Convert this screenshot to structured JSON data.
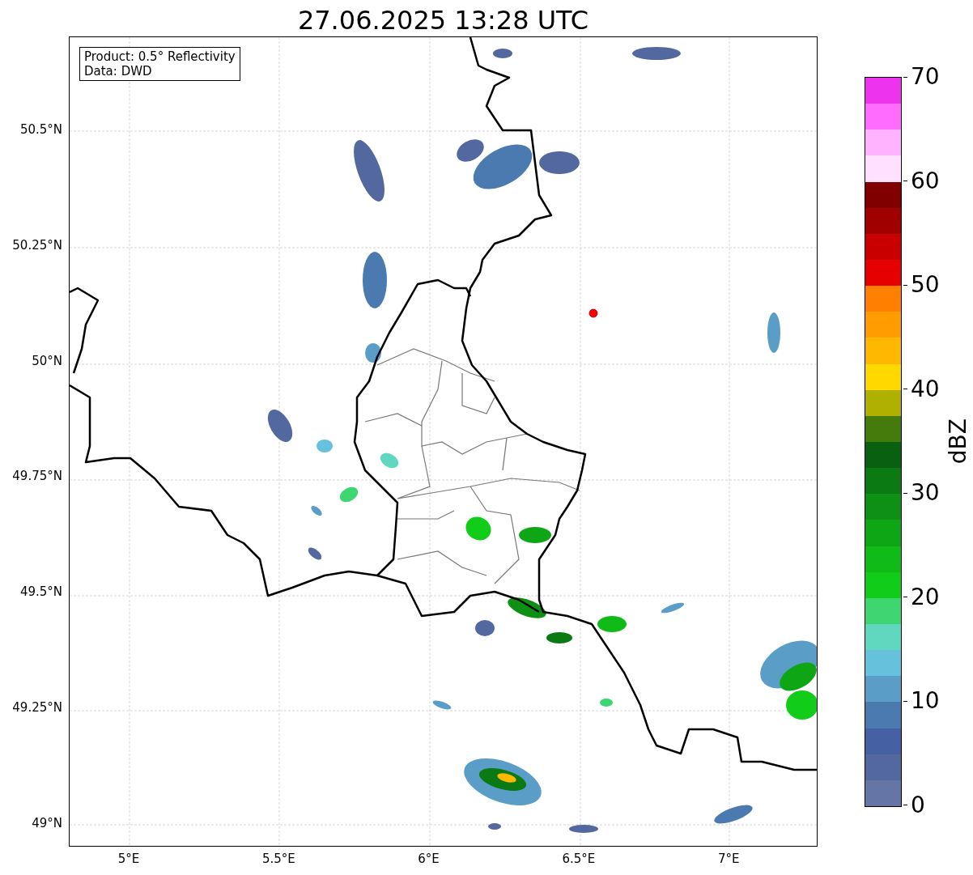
{
  "title": "27.06.2025 13:28 UTC",
  "legend": {
    "lines": [
      "Product: 0.5° Reflectivity",
      "Data: DWD"
    ]
  },
  "y_ticks": [
    "50.5°N",
    "50.25°N",
    "50°N",
    "49.75°N",
    "49.5°N",
    "49.25°N",
    "49°N"
  ],
  "x_ticks": [
    "5°E",
    "5.5°E",
    "6°E",
    "6.5°E",
    "7°E"
  ],
  "colorbar": {
    "label": "dBZ",
    "ticks": [
      "70",
      "60",
      "50",
      "40",
      "30",
      "20",
      "10",
      "0"
    ],
    "bins": [
      {
        "color": "#6475a6"
      },
      {
        "color": "#5468a0"
      },
      {
        "color": "#4560a3"
      },
      {
        "color": "#4a7ab0"
      },
      {
        "color": "#5a9ec8"
      },
      {
        "color": "#65c1dc"
      },
      {
        "color": "#60d8c0"
      },
      {
        "color": "#3ed670"
      },
      {
        "color": "#12cc1a"
      },
      {
        "color": "#10bb18"
      },
      {
        "color": "#0fa616"
      },
      {
        "color": "#0e9014"
      },
      {
        "color": "#0b7a12"
      },
      {
        "color": "#086010"
      },
      {
        "color": "#457a0c"
      },
      {
        "color": "#b0b000"
      },
      {
        "color": "#ffd800"
      },
      {
        "color": "#ffb800"
      },
      {
        "color": "#ff9c00"
      },
      {
        "color": "#ff8000"
      },
      {
        "color": "#e60000"
      },
      {
        "color": "#c80000"
      },
      {
        "color": "#a00000"
      },
      {
        "color": "#800000"
      },
      {
        "color": "#ffe0ff"
      },
      {
        "color": "#ffb3ff"
      },
      {
        "color": "#ff6cff"
      },
      {
        "color": "#ee33ee"
      }
    ]
  }
}
